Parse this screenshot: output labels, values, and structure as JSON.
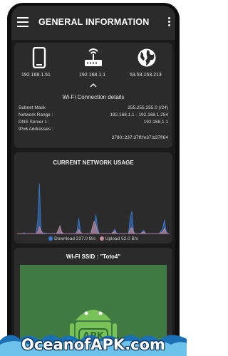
{
  "appbar": {
    "title": "GENERAL INFORMATION",
    "menu_icon": "hamburger-menu-icon",
    "more_icon": "more-vert-icon"
  },
  "devices": [
    {
      "icon": "phone-icon",
      "ip": "192.168.1.51"
    },
    {
      "icon": "router-icon",
      "ip": "192.168.1.1"
    },
    {
      "icon": "globe-icon",
      "ip": "53.53.153.213"
    }
  ],
  "wifi_details": {
    "title": "Wi-Fi Connection details",
    "rows": [
      {
        "key": "Subnet Mask",
        "value": "255.255.255.0 (/24)"
      },
      {
        "key": "Network Range :",
        "value": "192.168.1.1 - 192.168.1.254"
      },
      {
        "key": "DNS Server 1 :",
        "value": "192.168.1.1"
      },
      {
        "key": "IPv6 Addresses :",
        "value": ""
      },
      {
        "key": "",
        "value": "3780::237:37ff:fe37:b37f/64"
      }
    ]
  },
  "usage": {
    "title": "CURRENT NETWORK USAGE",
    "download_label": "Download 237.0  B/s",
    "upload_label": "Upload 52.0  B/s",
    "download_color": "#3a7bd5",
    "upload_color": "#c98a9a"
  },
  "chart_data": {
    "type": "area",
    "series": [
      {
        "name": "Download",
        "values": [
          0,
          0,
          0,
          0,
          1,
          0,
          0,
          0,
          0,
          0,
          0,
          0,
          14,
          58,
          4,
          0,
          1,
          0,
          0,
          0,
          0,
          0,
          0,
          0,
          2,
          6,
          1,
          0,
          0,
          0,
          0,
          0,
          0,
          0,
          0,
          3,
          18,
          2,
          0,
          0,
          0,
          0,
          0,
          0,
          4,
          10,
          22,
          6,
          0,
          0,
          0,
          0,
          0,
          0,
          0,
          0,
          2,
          5,
          1,
          0,
          0,
          0,
          0,
          0,
          0,
          0,
          18,
          26,
          2,
          0,
          0,
          0,
          0,
          2,
          4,
          0,
          0,
          0,
          0,
          0,
          0,
          0,
          0,
          0,
          3,
          6,
          16,
          3,
          0,
          0
        ]
      },
      {
        "name": "Upload",
        "values": [
          0,
          0,
          0,
          0,
          0,
          0,
          0,
          0,
          0,
          0,
          0,
          0,
          2,
          8,
          3,
          0,
          0,
          0,
          0,
          0,
          0,
          0,
          0,
          0,
          4,
          9,
          2,
          0,
          0,
          0,
          0,
          0,
          0,
          0,
          0,
          1,
          5,
          1,
          0,
          0,
          0,
          0,
          0,
          0,
          8,
          14,
          10,
          2,
          0,
          0,
          0,
          0,
          0,
          0,
          0,
          0,
          1,
          3,
          0,
          0,
          0,
          0,
          0,
          0,
          0,
          0,
          5,
          7,
          1,
          0,
          0,
          0,
          0,
          1,
          2,
          0,
          0,
          0,
          0,
          0,
          0,
          0,
          0,
          0,
          1,
          2,
          6,
          1,
          0,
          0
        ]
      }
    ]
  },
  "ssid": {
    "label": "WI-FI SSID : \"Toto4\"",
    "panel_color": "#3e7a42"
  },
  "watermark": {
    "text": "OceanofAPK.com",
    "badge_text": "APK"
  }
}
